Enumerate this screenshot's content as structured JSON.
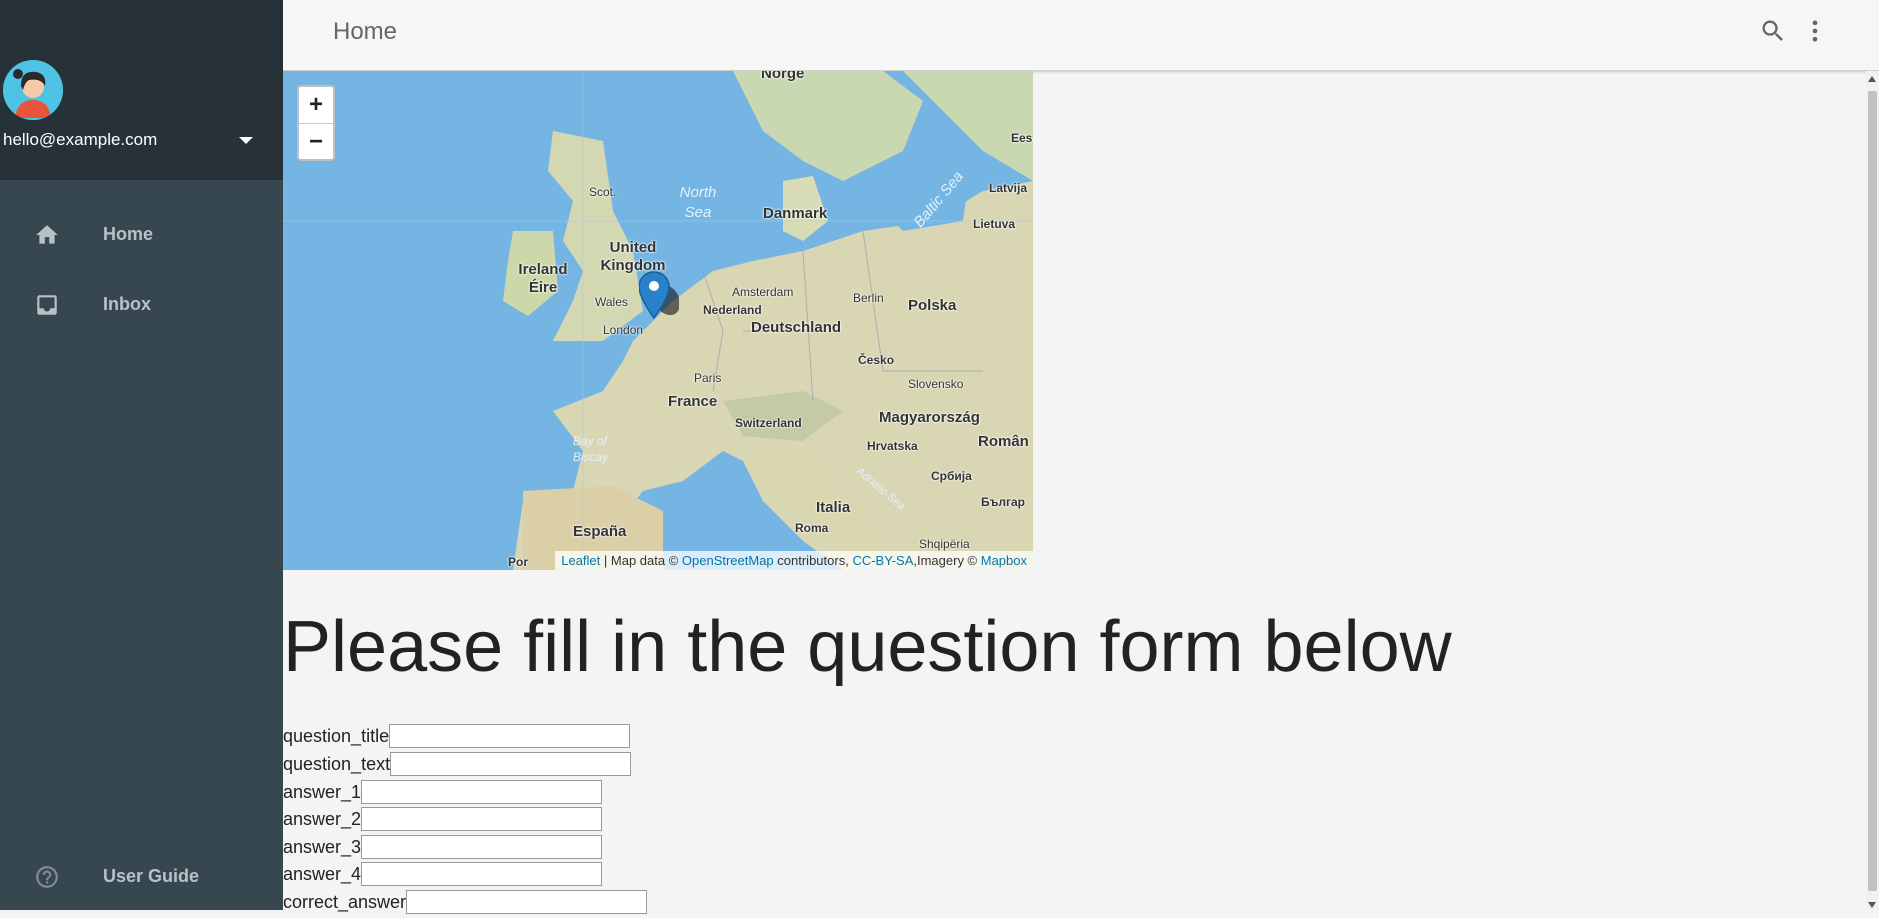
{
  "drawer": {
    "account_email": "hello@example.com",
    "nav_items": [
      {
        "label": "Home",
        "icon": "home-icon"
      },
      {
        "label": "Inbox",
        "icon": "inbox-icon"
      }
    ],
    "footer_item": {
      "label": "User Guide",
      "icon": "help-icon"
    }
  },
  "appbar": {
    "title": "Home",
    "icons": [
      "search-icon",
      "more-vert-icon"
    ]
  },
  "map": {
    "zoom_in_label": "+",
    "zoom_out_label": "−",
    "attribution": {
      "leaflet": "Leaflet",
      "sep1": " | Map data © ",
      "osm": "OpenStreetMap",
      "contributors": " contributors, ",
      "license": "CC-BY-SA",
      "imagery": ",Imagery © ",
      "mapbox": "Mapbox"
    },
    "labels": {
      "norge": "Norge",
      "north_sea": "North Sea",
      "danmark": "Danmark",
      "baltic": "Baltic Sea",
      "eesti": "Eesti",
      "latvija": "Latvija",
      "lietuva": "Lietuva",
      "scot": "Scot.",
      "united_kingdom": "United Kingdom",
      "ireland": "Ireland Éire",
      "wales": "Wales",
      "london": "London",
      "amsterdam": "Amsterdam",
      "nederland": "Nederland",
      "berlin": "Berlin",
      "polska": "Polska",
      "deutschland": "Deutschland",
      "cesko": "Česko",
      "paris": "Paris",
      "france": "France",
      "slovensko": "Slovensko",
      "switzerland": "Switzerland",
      "magyarorszag": "Magyarország",
      "hrvatska": "Hrvatska",
      "romania": "Român",
      "srbija": "Србија",
      "bay_biscay": "Bay of Biscay",
      "italia": "Italia",
      "roma": "Roma",
      "espana": "España",
      "bulgaria": "Българ",
      "shqiperia": "Shqipëria",
      "adriatic": "Adriatic Sea",
      "portugal": "Por"
    }
  },
  "content": {
    "heading": "Please fill in the question form below",
    "fields": [
      {
        "label": "question_title",
        "value": ""
      },
      {
        "label": "question_text",
        "value": ""
      },
      {
        "label": "answer_1",
        "value": ""
      },
      {
        "label": "answer_2",
        "value": ""
      },
      {
        "label": "answer_3",
        "value": ""
      },
      {
        "label": "answer_4",
        "value": ""
      },
      {
        "label": "correct_answer",
        "value": ""
      }
    ]
  }
}
